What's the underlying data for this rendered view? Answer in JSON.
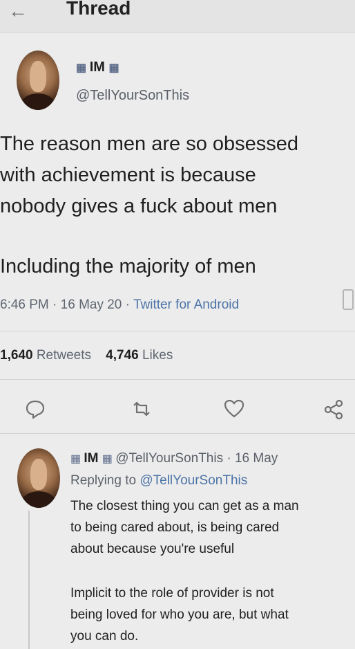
{
  "header": {
    "back_icon": "arrow-left-icon",
    "title": "Thread"
  },
  "tweet": {
    "name": "IM",
    "flag_icon": "uk-flag-icon",
    "handle": "@TellYourSonThis",
    "text_lines": [
      "The reason men are so obsessed",
      "with achievement is because",
      "nobody gives a fuck about men"
    ],
    "text_line_last": "Including the majority of men",
    "time": "6:46 PM",
    "date": "16 May 20",
    "app": "Twitter for Android",
    "retweets_count": "1,640",
    "retweets_label": "Retweets",
    "likes_count": "4,746",
    "likes_label": "Likes"
  },
  "actions": {
    "reply_icon": "reply-icon",
    "retweet_icon": "retweet-icon",
    "like_icon": "heart-icon",
    "share_icon": "share-icon"
  },
  "reply": {
    "name": "IM",
    "handle": "@TellYourSonThis",
    "date": "16 May",
    "replying_prefix": "Replying to",
    "replying_handle": "@TellYourSonThis",
    "para1": [
      "The closest thing you can get as a man",
      "to being cared about, is being cared",
      "about because you're useful"
    ],
    "para2": [
      "Implicit to the role of provider is not",
      "being loved for who you are, but what",
      "you can do."
    ]
  }
}
